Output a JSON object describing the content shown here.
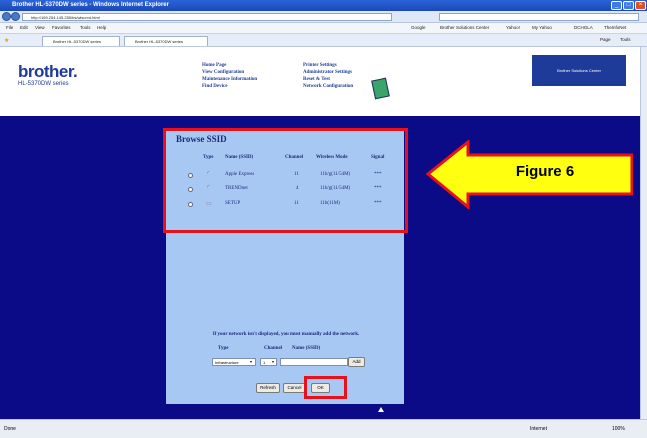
{
  "window": {
    "title": "Brother HL-5370DW series - Windows Internet Explorer",
    "minimize": "_",
    "maximize": "□",
    "close": "×"
  },
  "browser": {
    "address": "http://169.254.145.255/bs/wlsurvd.html",
    "menu": [
      "File",
      "Edit",
      "View",
      "Favorites",
      "Tools",
      "Help"
    ],
    "tabs": [
      "Brother HL-5370DW series",
      "Brother HL-5370DW series"
    ],
    "links_bar": [
      "Google",
      "Brother Solutions Center",
      "Yahoo!",
      "My Yahoo",
      "DCHGLA",
      "TheInfoNet"
    ],
    "toolbar_right": [
      "Page",
      "Tools"
    ]
  },
  "header": {
    "brand": "brother.",
    "model": "HL-5370DW series",
    "nav_left": [
      "Home Page",
      "View Configuration",
      "Maintenance Information",
      "Find Device"
    ],
    "nav_right": [
      "Printer Settings",
      "Administrator Settings",
      "Reset & Test",
      "Network Configuration"
    ],
    "solutions": "Brother Solutions Center"
  },
  "browse": {
    "title": "Browse SSID",
    "columns": [
      "Type",
      "Name (SSID)",
      "Channel",
      "Wireless Mode",
      "Signal"
    ],
    "rows": [
      {
        "name": "Apple Express",
        "channel": "11",
        "mode": "11b/g(11/54M)",
        "signal": "***"
      },
      {
        "name": "TRENDnet",
        "channel": "4",
        "mode": "11b/g(11/54M)",
        "signal": "***"
      },
      {
        "name": "SETUP",
        "channel": "11",
        "mode": "11b(11M)",
        "signal": "***"
      }
    ]
  },
  "manual": {
    "note": "If your network isn't displayed, you must manually add the network.",
    "type_label": "Type",
    "channel_label": "Channel",
    "name_label": "Name (SSID)",
    "type_value": "Infrastructure",
    "channel_value": "1",
    "add_label": "Add"
  },
  "buttons": {
    "refresh": "Refresh",
    "cancel": "Cancel",
    "ok": "OK"
  },
  "callout": {
    "text": "Figure 6",
    "highlight_color": "#e8101a",
    "fill_color": "#ffff10"
  },
  "status": {
    "left": "Done",
    "zone": "Internet",
    "zoom": "100%"
  }
}
